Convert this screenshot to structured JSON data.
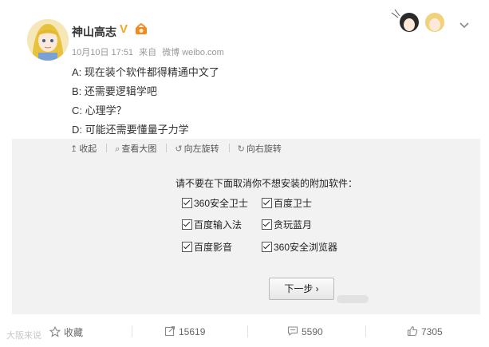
{
  "post": {
    "author": "神山高志",
    "meta": {
      "time": "10月10日 17:51",
      "via": "来自",
      "source": "微博 weibo.com"
    },
    "lines": [
      "A: 现在装个软件都得精通中文了",
      "B: 还需要逻辑学吧",
      "C: 心理学？",
      "D: 可能还需要懂量子力学"
    ]
  },
  "image_toolbar": {
    "collapse": "收起",
    "view_large": "查看大图",
    "rotate_left": "向左旋转",
    "rotate_right": "向右旋转"
  },
  "dialog": {
    "prompt": "请不要在下面取消你不想安装的附加软件：",
    "options": [
      {
        "label": "360安全卫士",
        "checked": true
      },
      {
        "label": "百度卫士",
        "checked": true
      },
      {
        "label": "百度输入法",
        "checked": true
      },
      {
        "label": "贪玩蓝月",
        "checked": true
      },
      {
        "label": "百度影音",
        "checked": true
      },
      {
        "label": "360安全浏览器",
        "checked": true
      }
    ],
    "next_button": "下一步 ›"
  },
  "footer": {
    "favorite": "收藏",
    "repost_count": "15619",
    "comment_count": "5590",
    "like_count": "7305",
    "watermark": "大阪来说"
  },
  "colors": {
    "accent_badge": "#f5a623",
    "panel_bg": "#f2f2f2",
    "muted_text": "#999999"
  },
  "icons": [
    "v-badge-icon",
    "level-badge-icon",
    "chevron-down-icon",
    "collapse-icon",
    "magnifier-icon",
    "rotate-left-icon",
    "rotate-right-icon",
    "star-icon",
    "repost-icon",
    "comment-icon",
    "thumbs-up-icon"
  ]
}
